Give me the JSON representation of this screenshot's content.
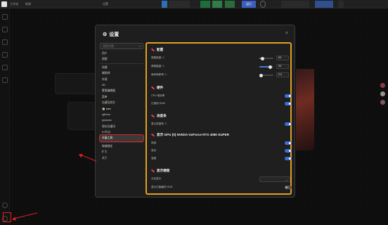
{
  "topbar": {
    "tabs": [
      "工作流",
      "新建",
      "设置"
    ],
    "run_label": "运行",
    "run_color": "#3a5fbf"
  },
  "modal": {
    "title": "设置",
    "close_glyph": "×",
    "search_placeholder": "搜索设置...",
    "nav": [
      {
        "label": "用户",
        "active": false
      },
      {
        "label": "视图",
        "active": false
      },
      {
        "sep": true
      },
      {
        "label": "快捷",
        "active": false
      },
      {
        "label": "辅助线",
        "active": false
      },
      {
        "label": "外观",
        "active": false
      },
      {
        "label": "3D",
        "active": false
      },
      {
        "label": "蒙版编辑器",
        "active": false
      },
      {
        "label": "菜单",
        "active": false
      },
      {
        "label": "右键及其它",
        "active": false
      },
      {
        "label": "🏠 ●●●",
        "active": false
      },
      {
        "label": "rgthree",
        "active": false
      },
      {
        "label": "pysssss",
        "active": false
      },
      {
        "label": "保存及通讯",
        "active": false
      },
      {
        "label": "KJ节点",
        "active": false
      },
      {
        "label": "水晶工具",
        "active": true
      },
      {
        "sep": true
      },
      {
        "label": "按键绑定",
        "active": false
      },
      {
        "label": "扩大",
        "active": false
      },
      {
        "label": "关于",
        "active": false
      }
    ],
    "sections": {
      "config": {
        "title": "配置",
        "rows": [
          {
            "label": "像素宽度 ⓘ",
            "value": "55",
            "fraction": 0.2
          },
          {
            "label": "像素高度 ⓘ",
            "value": "35",
            "fraction": 0.75
          },
          {
            "label": "每秒刷新率 ⓘ",
            "value": "0.5",
            "fraction": 0.1
          }
        ]
      },
      "hardware": {
        "title": "硬件",
        "rows": [
          {
            "label": "CPU 使用率",
            "on": true
          },
          {
            "label": "已使用 RAM",
            "on": true
          }
        ]
      },
      "processes": {
        "title": "进度条",
        "rows": [
          {
            "label": "显示进度条 ⓘ",
            "on": true
          }
        ]
      },
      "gpu": {
        "title": "显示 GPU [0] NVIDIA GeForce RTX 4080 SUPER",
        "rows": [
          {
            "label": "用途",
            "on": true
          },
          {
            "label": "显存",
            "on": true
          },
          {
            "label": "温度",
            "on": true
          }
        ]
      },
      "disk": {
        "title": "显示硬盘",
        "rows": [
          {
            "label": "分区显示",
            "type": "select",
            "value": ""
          },
          {
            "label": "显示已隐藏的 HDD",
            "on": false
          }
        ]
      }
    }
  },
  "colors": {
    "highlight_border": "#e0a020",
    "annotation_red": "#e02020",
    "toggle_on": "#3e6fd6"
  }
}
